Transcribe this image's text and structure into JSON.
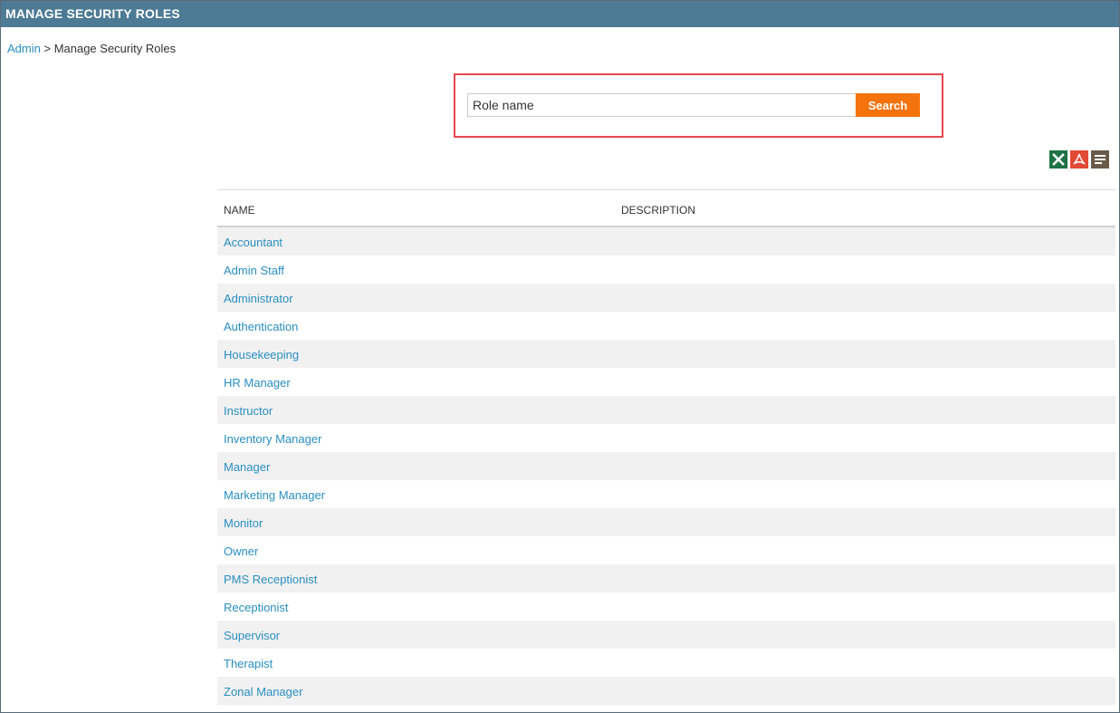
{
  "header": {
    "title": "MANAGE SECURITY ROLES"
  },
  "breadcrumb": {
    "root": "Admin",
    "separator": " > ",
    "current": "Manage Security Roles"
  },
  "search": {
    "value": "Role name",
    "button_label": "Search"
  },
  "export": {
    "icons": [
      "excel-icon",
      "pdf-icon",
      "text-export-icon"
    ]
  },
  "grid": {
    "columns": [
      "NAME",
      "DESCRIPTION"
    ],
    "rows": [
      {
        "name": "Accountant",
        "description": ""
      },
      {
        "name": "Admin Staff",
        "description": ""
      },
      {
        "name": "Administrator",
        "description": ""
      },
      {
        "name": "Authentication",
        "description": ""
      },
      {
        "name": "Housekeeping",
        "description": ""
      },
      {
        "name": "HR Manager",
        "description": ""
      },
      {
        "name": "Instructor",
        "description": ""
      },
      {
        "name": "Inventory Manager",
        "description": ""
      },
      {
        "name": "Manager",
        "description": ""
      },
      {
        "name": "Marketing Manager",
        "description": ""
      },
      {
        "name": "Monitor",
        "description": ""
      },
      {
        "name": "Owner",
        "description": ""
      },
      {
        "name": "PMS Receptionist",
        "description": ""
      },
      {
        "name": "Receptionist",
        "description": ""
      },
      {
        "name": "Supervisor",
        "description": ""
      },
      {
        "name": "Therapist",
        "description": ""
      },
      {
        "name": "Zonal Manager",
        "description": ""
      }
    ]
  },
  "colors": {
    "header_bg": "#4d7b96",
    "link": "#2a8fc2",
    "search_button": "#f5730d",
    "highlight_border": "#e8464f"
  }
}
